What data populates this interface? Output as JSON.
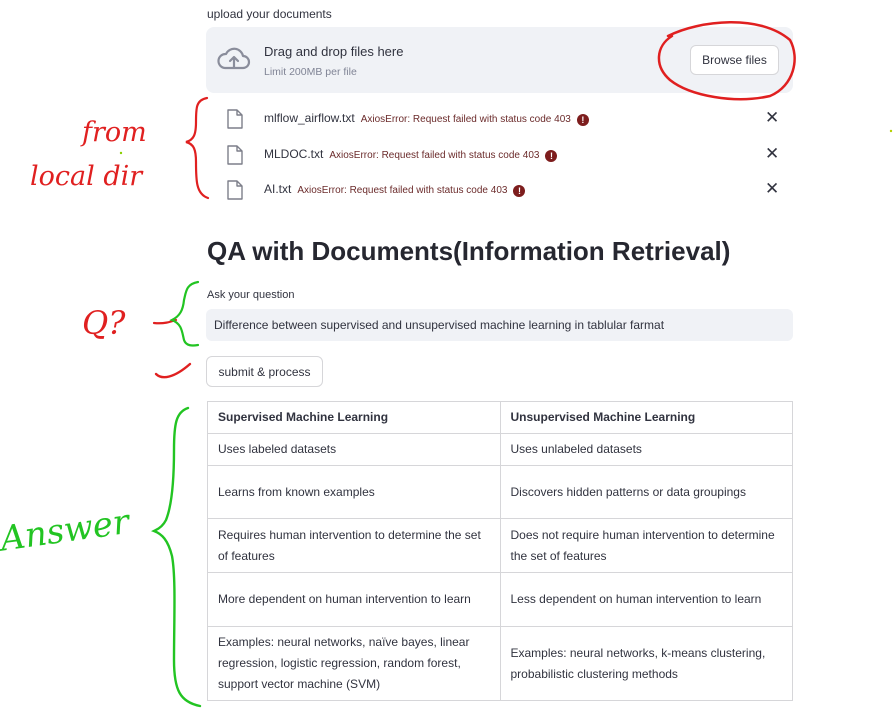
{
  "uploader": {
    "label": "upload your documents",
    "drop_title": "Drag and drop files here",
    "limit": "Limit 200MB per file",
    "browse_label": "Browse files"
  },
  "files": [
    {
      "name": "mlflow_airflow.txt",
      "error": "AxiosError: Request failed with status code 403",
      "badge": "!",
      "close": "✕"
    },
    {
      "name": "MLDOC.txt",
      "error": "AxiosError: Request failed with status code 403",
      "badge": "!",
      "close": "✕"
    },
    {
      "name": "AI.txt",
      "error": "AxiosError: Request failed with status code 403",
      "badge": "!",
      "close": "✕"
    }
  ],
  "qa": {
    "title": "QA with Documents(Information Retrieval)",
    "question_label": "Ask your question",
    "question_value": "Difference between supervised and unsupervised machine learning in tablular farmat",
    "submit_label": "submit & process"
  },
  "answer_table": {
    "headers": [
      "Supervised Machine Learning",
      "Unsupervised Machine Learning"
    ],
    "rows": [
      [
        "Uses labeled datasets",
        "Uses unlabeled datasets"
      ],
      [
        "Learns from known examples",
        "Discovers hidden patterns or data groupings"
      ],
      [
        "Requires human intervention to determine the set of features",
        "Does not require human intervention to determine the set of features"
      ],
      [
        "More dependent on human intervention to learn",
        "Less dependent on human intervention to learn"
      ],
      [
        "Examples: neural networks, naïve bayes, linear regression, logistic regression, random forest, support vector machine (SVM)",
        "Examples: neural networks, k-means clustering, probabilistic clustering methods"
      ]
    ]
  },
  "annotations": {
    "from_local_dir": [
      "from",
      "local dir"
    ],
    "question": "Q?",
    "answer": "Answer",
    "red": "#e02020",
    "green": "#22c422"
  },
  "icons": {
    "upload": "cloud-upload-icon",
    "file": "file-icon",
    "error": "error-icon",
    "close": "close-icon"
  },
  "colors": {
    "dropzone_bg": "#f0f2f6",
    "error_badge": "#7d1d1d"
  }
}
